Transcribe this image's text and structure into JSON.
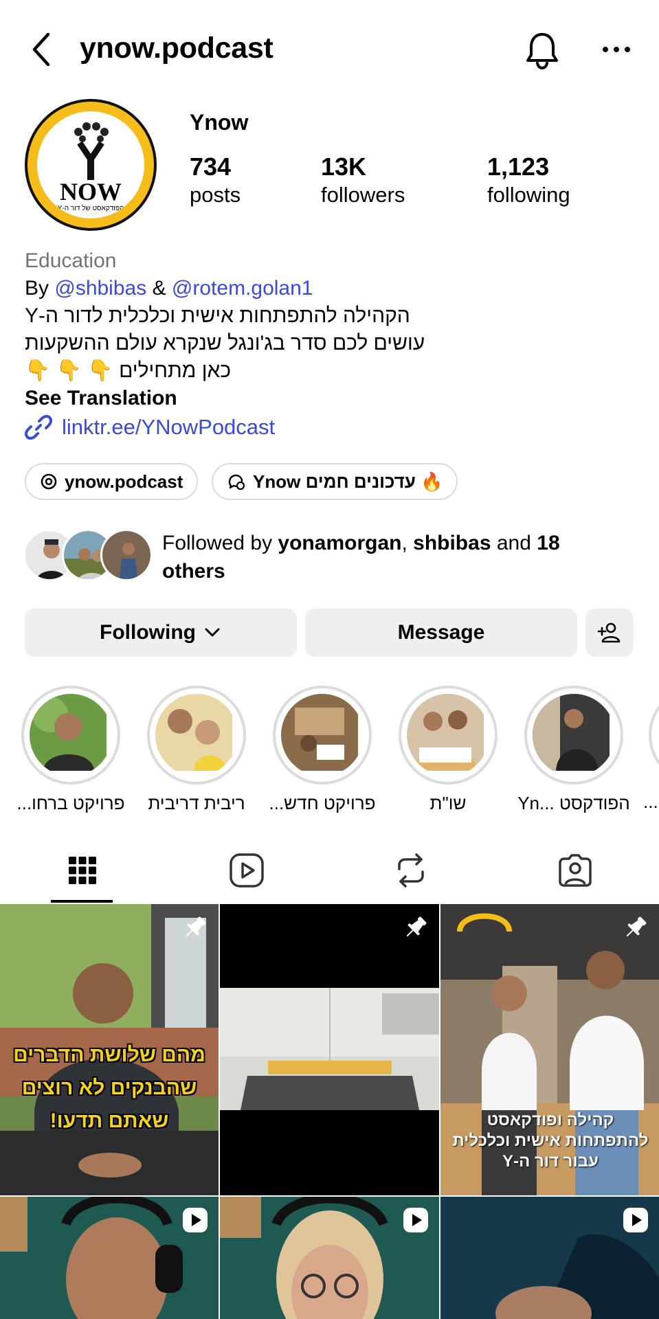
{
  "header": {
    "username": "ynow.podcast"
  },
  "profile": {
    "display_name": "Ynow",
    "avatar_text": "NOW",
    "avatar_subtext": "הפודקאסט של דור ה-Y",
    "stats": [
      {
        "value": "734",
        "label": "posts"
      },
      {
        "value": "13K",
        "label": "followers"
      },
      {
        "value": "1,123",
        "label": "following"
      }
    ]
  },
  "bio": {
    "category": "Education",
    "by_prefix": "By",
    "mention1": "@shbibas",
    "amp": "&",
    "mention2": "@rotem.golan1",
    "line1": "הקהילה להתפתחות אישית וכלכלית לדור ה-Y",
    "line2": "עושים לכם סדר בג'ונגל שנקרא עולם ההשקעות",
    "line3": "כאן מתחילים 👇 👇 👇",
    "see_translation": "See Translation",
    "link": "linktr.ee/YNowPodcast"
  },
  "chips": [
    {
      "label": "ynow.podcast",
      "icon": "threads-icon"
    },
    {
      "label": "Ynow עדכונים חמים 🔥",
      "icon": "channel-icon"
    }
  ],
  "followed_by": {
    "prefix": "Followed by",
    "user1": "yonamorgan",
    "sep": ",",
    "user2": "shbibas",
    "and": "and",
    "count": "18",
    "suffix": "others"
  },
  "actions": {
    "following": "Following",
    "message": "Message"
  },
  "highlights": [
    {
      "label": "פרויקט ברחו..."
    },
    {
      "label": "ריבית דריבית"
    },
    {
      "label": "פרויקט חדש..."
    },
    {
      "label": "שו\"ת"
    },
    {
      "label": "הפודקסט ...Yn"
    },
    {
      "label": "..."
    }
  ],
  "tabs": [
    "grid-icon",
    "reels-icon",
    "reposts-icon",
    "tagged-icon"
  ],
  "posts": [
    {
      "caption": "מהם שלושת הדברים שהבנקים לא רוצים שאתם תדעו!",
      "pinned": true
    },
    {
      "caption": "",
      "pinned": true
    },
    {
      "caption": "קהילה ופודקאסט להתפתחות אישית וכלכלית עבור דור ה-Y",
      "pinned": true
    },
    {
      "caption": "",
      "reel": true
    },
    {
      "caption": "",
      "reel": true
    },
    {
      "caption": "",
      "reel": true
    }
  ],
  "colors": {
    "link": "#3949d8",
    "brand_yellow": "#f6bd1a",
    "button_bg": "#efefef",
    "muted": "#737373"
  }
}
